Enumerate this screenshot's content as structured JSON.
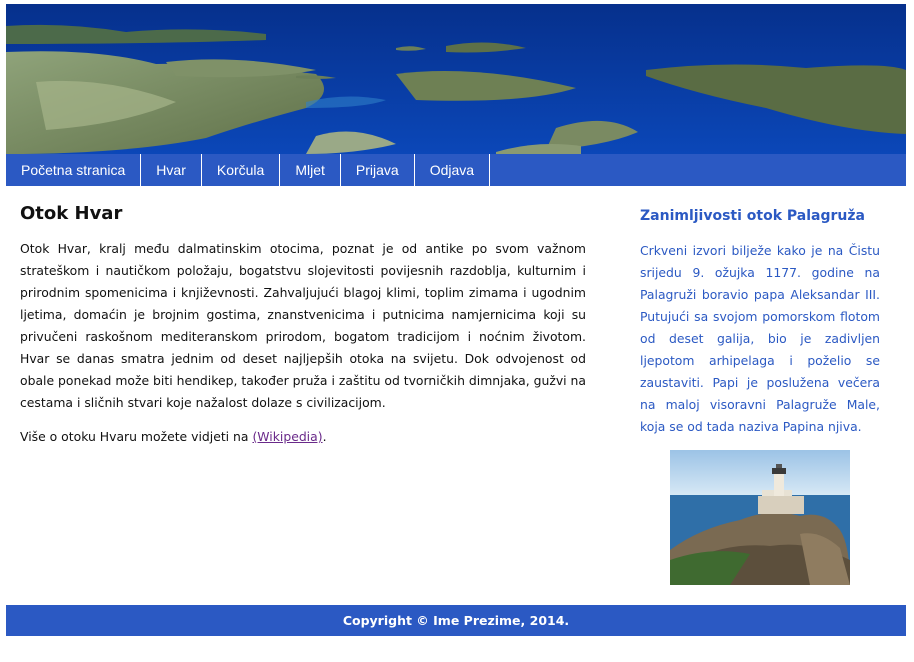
{
  "nav": {
    "items": [
      "Početna stranica",
      "Hvar",
      "Korčula",
      "Mljet",
      "Prijava",
      "Odjava"
    ]
  },
  "main": {
    "title": "Otok Hvar",
    "paragraph": "Otok Hvar, kralj među dalmatinskim otocima, poznat je od antike po svom važnom strateškom i nautičkom položaju, bogatstvu slojevitosti povijesnih razdoblja, kulturnim i prirodnim spomenicima i književnosti. Zahvaljujući blagoj klimi, toplim zimama i ugodnim ljetima, domaćin je brojnim gostima, znanstvenicima i putnicima namjernicima koji su privučeni raskošnom mediteranskom prirodom, bogatom tradicijom i noćnim životom. Hvar se danas smatra jednim od deset najljepših otoka na svijetu. Dok odvojenost od obale ponekad može biti hendikep, također pruža i zaštitu od tvorničkih dimnjaka, gužvi na cestama i sličnih stvari koje nažalost dolaze s civilizacijom.",
    "more_prefix": "Više o otoku Hvaru možete vidjeti na ",
    "more_link": "(Wikipedia)",
    "more_suffix": "."
  },
  "sidebar": {
    "title": "Zanimljivosti otok Palagruža",
    "text": "Crkveni izvori bilježe kako je na Čistu srijedu 9. ožujka 1177. godine na Palagruži boravio papa Aleksandar III. Putujući sa svojom pomorskom flotom od deset galija, bio je zadivljen ljepotom arhipelaga i poželio se zaustaviti. Papi je poslužena večera na maloj visoravni Palagruže Male, koja se od tada naziva Papina njiva."
  },
  "footer": {
    "text": "Copyright © Ime Prezime, 2014."
  },
  "colors": {
    "accent": "#2b59c3",
    "link": "#6a2a8a",
    "text": "#111111",
    "sea": "#0a3aa0"
  }
}
